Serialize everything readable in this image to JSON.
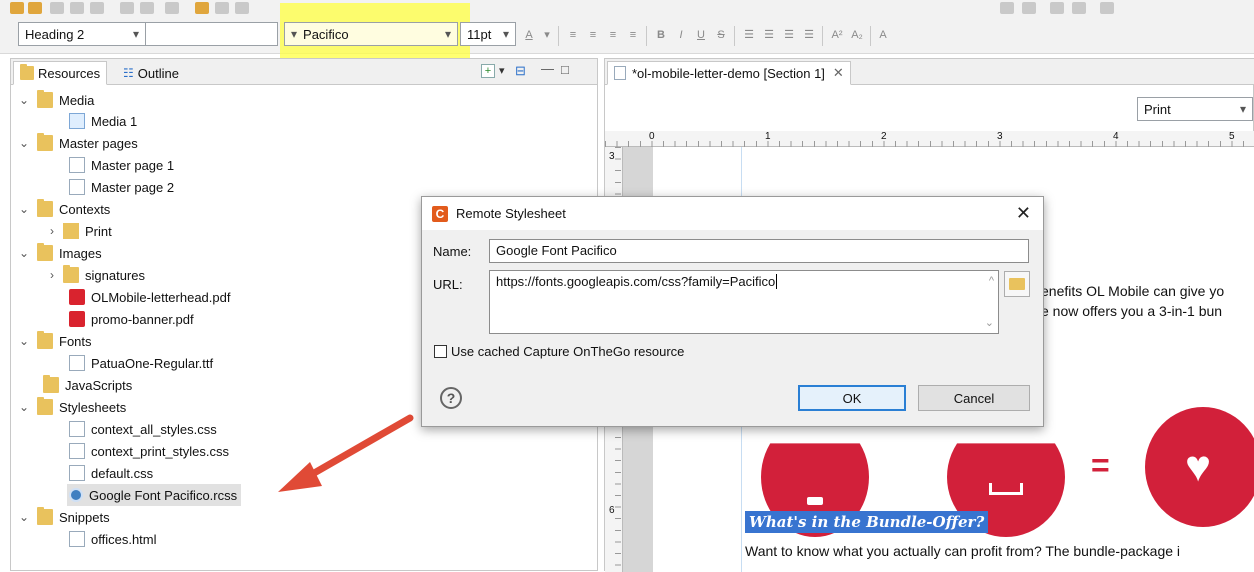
{
  "toolbar": {
    "style_select": "Heading 2",
    "font_select": "Pacifico",
    "size_select": "11pt",
    "underline_label": "A"
  },
  "left_panel": {
    "tabs": [
      {
        "label": "Resources"
      },
      {
        "label": "Outline"
      }
    ],
    "tree": [
      {
        "label": "Media"
      },
      {
        "label": "Media 1"
      },
      {
        "label": "Master pages"
      },
      {
        "label": "Master page 1"
      },
      {
        "label": "Master page 2"
      },
      {
        "label": "Contexts"
      },
      {
        "label": "Print"
      },
      {
        "label": "Images"
      },
      {
        "label": "signatures"
      },
      {
        "label": "OLMobile-letterhead.pdf"
      },
      {
        "label": "promo-banner.pdf"
      },
      {
        "label": "Fonts"
      },
      {
        "label": "PatuaOne-Regular.ttf"
      },
      {
        "label": "JavaScripts"
      },
      {
        "label": "Stylesheets"
      },
      {
        "label": "context_all_styles.css"
      },
      {
        "label": "context_print_styles.css"
      },
      {
        "label": "default.css"
      },
      {
        "label": "Google Font Pacifico.rcss"
      },
      {
        "label": "Snippets"
      },
      {
        "label": "offices.html"
      }
    ]
  },
  "editor": {
    "tab_title": "*ol-mobile-letter-demo [Section 1]",
    "media_select": "Print",
    "ruler_ticks": [
      "0",
      "1",
      "2",
      "3",
      "4",
      "5"
    ],
    "vruler_ticks": [
      "3",
      "6"
    ],
    "body_text_1": "enefits OL Mobile can give yo",
    "body_text_2": "e now offers you a 3-in-1 bun",
    "equals": "=",
    "heading": "What's in the Bundle-Offer?",
    "body_text_3": "Want to know what you actually can profit from? The bundle-package i"
  },
  "dialog": {
    "title": "Remote Stylesheet",
    "name_label": "Name:",
    "name_value": "Google Font Pacifico",
    "url_label": "URL:",
    "url_value": "https://fonts.googleapis.com/css?family=Pacifico",
    "checkbox_label": "Use cached Capture OnTheGo resource",
    "ok_label": "OK",
    "cancel_label": "Cancel",
    "help_glyph": "?"
  },
  "colors": {
    "accent_red": "#d2203a",
    "highlight_yellow": "#ffff40",
    "selection_blue": "#3874d0",
    "arrow": "#e04a36"
  }
}
